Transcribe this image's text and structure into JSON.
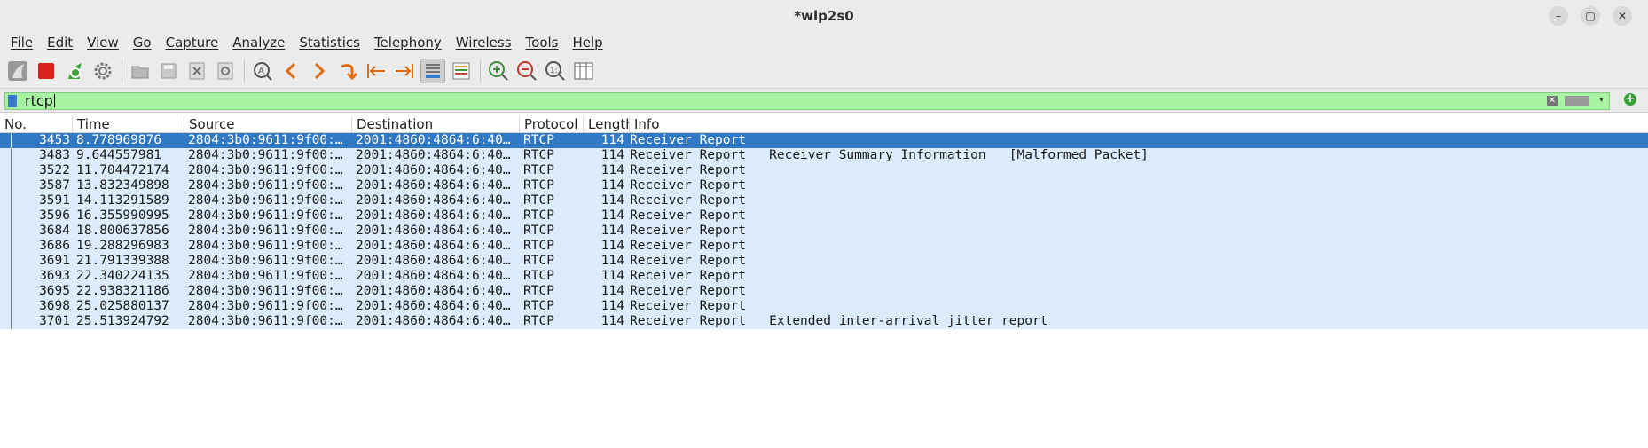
{
  "window": {
    "title": "*wlp2s0"
  },
  "menu": [
    "File",
    "Edit",
    "View",
    "Go",
    "Capture",
    "Analyze",
    "Statistics",
    "Telephony",
    "Wireless",
    "Tools",
    "Help"
  ],
  "filter": {
    "value": "rtcp"
  },
  "columns": {
    "no": "No.",
    "time": "Time",
    "source": "Source",
    "destination": "Destination",
    "protocol": "Protocol",
    "length": "Length",
    "info": "Info"
  },
  "packets": [
    {
      "no": "3453",
      "time": "8.778969876",
      "source": "2804:3b0:9611:9f00:…",
      "destination": "2001:4860:4864:6:40…",
      "protocol": "RTCP",
      "length": "114",
      "info": "Receiver Report"
    },
    {
      "no": "3483",
      "time": "9.644557981",
      "source": "2804:3b0:9611:9f00:…",
      "destination": "2001:4860:4864:6:40…",
      "protocol": "RTCP",
      "length": "114",
      "info": "Receiver Report   Receiver Summary Information   [Malformed Packet]"
    },
    {
      "no": "3522",
      "time": "11.704472174",
      "source": "2804:3b0:9611:9f00:…",
      "destination": "2001:4860:4864:6:40…",
      "protocol": "RTCP",
      "length": "114",
      "info": "Receiver Report"
    },
    {
      "no": "3587",
      "time": "13.832349898",
      "source": "2804:3b0:9611:9f00:…",
      "destination": "2001:4860:4864:6:40…",
      "protocol": "RTCP",
      "length": "114",
      "info": "Receiver Report"
    },
    {
      "no": "3591",
      "time": "14.113291589",
      "source": "2804:3b0:9611:9f00:…",
      "destination": "2001:4860:4864:6:40…",
      "protocol": "RTCP",
      "length": "114",
      "info": "Receiver Report"
    },
    {
      "no": "3596",
      "time": "16.355990995",
      "source": "2804:3b0:9611:9f00:…",
      "destination": "2001:4860:4864:6:40…",
      "protocol": "RTCP",
      "length": "114",
      "info": "Receiver Report"
    },
    {
      "no": "3684",
      "time": "18.800637856",
      "source": "2804:3b0:9611:9f00:…",
      "destination": "2001:4860:4864:6:40…",
      "protocol": "RTCP",
      "length": "114",
      "info": "Receiver Report"
    },
    {
      "no": "3686",
      "time": "19.288296983",
      "source": "2804:3b0:9611:9f00:…",
      "destination": "2001:4860:4864:6:40…",
      "protocol": "RTCP",
      "length": "114",
      "info": "Receiver Report"
    },
    {
      "no": "3691",
      "time": "21.791339388",
      "source": "2804:3b0:9611:9f00:…",
      "destination": "2001:4860:4864:6:40…",
      "protocol": "RTCP",
      "length": "114",
      "info": "Receiver Report"
    },
    {
      "no": "3693",
      "time": "22.340224135",
      "source": "2804:3b0:9611:9f00:…",
      "destination": "2001:4860:4864:6:40…",
      "protocol": "RTCP",
      "length": "114",
      "info": "Receiver Report"
    },
    {
      "no": "3695",
      "time": "22.938321186",
      "source": "2804:3b0:9611:9f00:…",
      "destination": "2001:4860:4864:6:40…",
      "protocol": "RTCP",
      "length": "114",
      "info": "Receiver Report"
    },
    {
      "no": "3698",
      "time": "25.025880137",
      "source": "2804:3b0:9611:9f00:…",
      "destination": "2001:4860:4864:6:40…",
      "protocol": "RTCP",
      "length": "114",
      "info": "Receiver Report"
    },
    {
      "no": "3701",
      "time": "25.513924792",
      "source": "2804:3b0:9611:9f00:…",
      "destination": "2001:4860:4864:6:40…",
      "protocol": "RTCP",
      "length": "114",
      "info": "Receiver Report   Extended inter-arrival jitter report"
    }
  ],
  "selected_row": 0
}
